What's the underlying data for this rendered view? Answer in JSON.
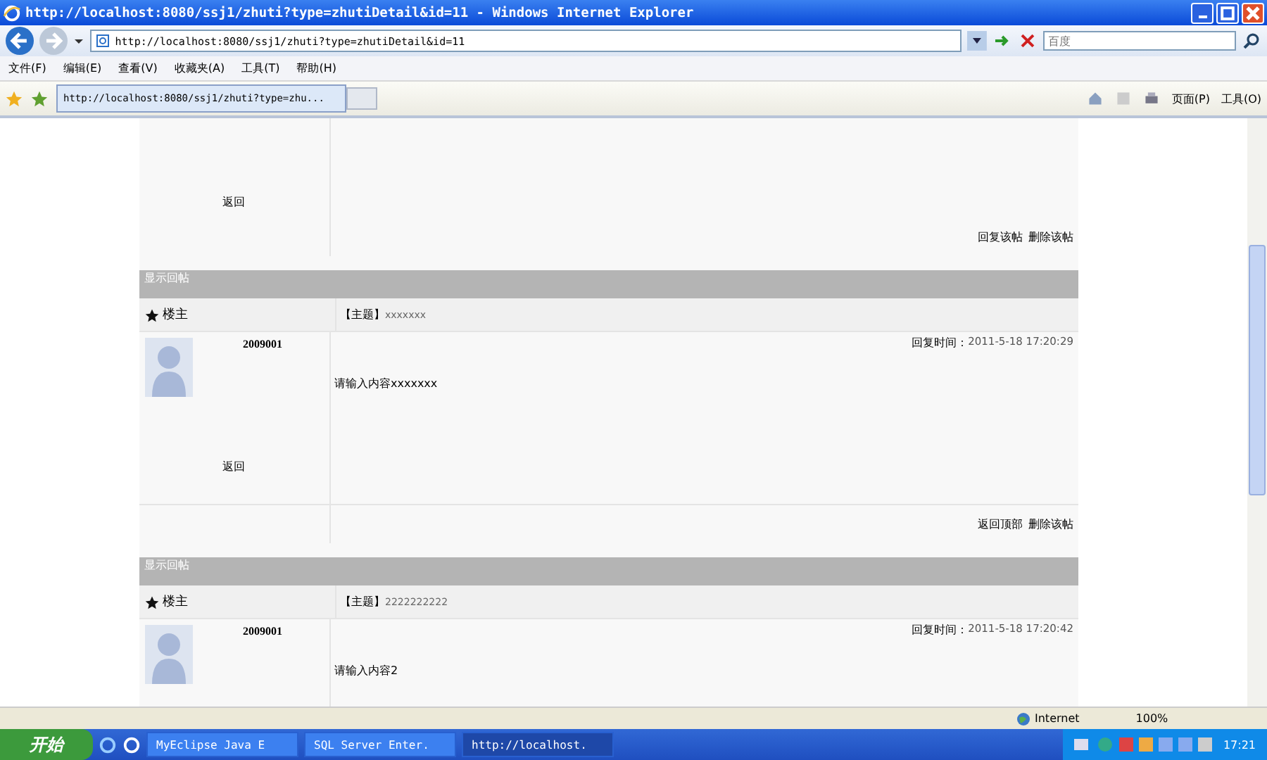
{
  "window": {
    "title": "http://localhost:8080/ssj1/zhuti?type=zhutiDetail&id=11 - Windows Internet Explorer"
  },
  "address_bar": {
    "value": "http://localhost:8080/ssj1/zhuti?type=zhutiDetail&id=11",
    "search_placeholder": "百度"
  },
  "menu": [
    "文件(F)",
    "编辑(E)",
    "查看(V)",
    "收藏夹(A)",
    "工具(T)",
    "帮助(H)"
  ],
  "tabs": [
    {
      "label": "http://localhost:8080/ssj1/zhuti?type=zhu...",
      "selected": true
    }
  ],
  "command_bar": [
    "页面(P)",
    "工具(O)"
  ],
  "top_post": {
    "back": "返回",
    "actions": [
      "回复该帖",
      "删除该帖"
    ]
  },
  "posts": [
    {
      "header": "显示回帖",
      "role": "楼主",
      "subject_label": "【主题】",
      "subject": "xxxxxxx",
      "user": "2009001",
      "time_label": "回复时间：",
      "time": "2011-5-18 17:20:29",
      "content": "请输入内容xxxxxxx",
      "back": "返回",
      "actions": [
        "返回顶部",
        "删除该帖"
      ]
    },
    {
      "header": "显示回帖",
      "role": "楼主",
      "subject_label": "【主题】",
      "subject": "2222222222",
      "user": "2009001",
      "time_label": "回复时间：",
      "time": "2011-5-18 17:20:42",
      "content": "请输入内容2"
    }
  ],
  "status_bar": {
    "zone": "Internet",
    "zoom": "100%"
  },
  "taskbar": {
    "start": "开始",
    "tasks": [
      {
        "label": "MyEclipse Java E",
        "selected": false
      },
      {
        "label": "SQL Server Enter.",
        "selected": false
      },
      {
        "label": "http://localhost.",
        "selected": true
      }
    ],
    "clock": "17:21"
  }
}
